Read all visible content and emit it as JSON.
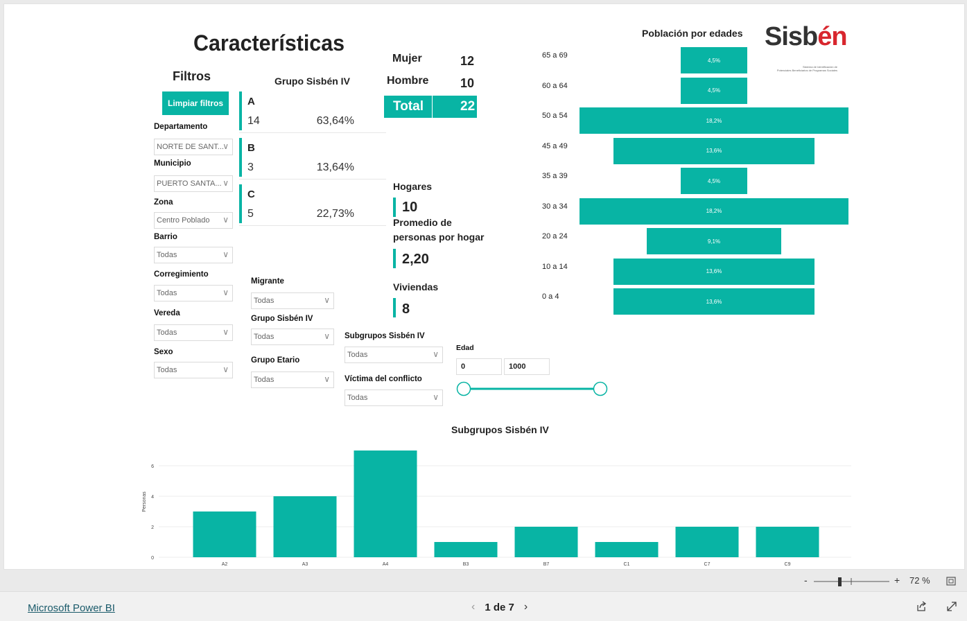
{
  "report": {
    "title": "Características",
    "filters_title": "Filtros",
    "clear_button": "Limpiar filtros",
    "filters": [
      {
        "label": "Departamento",
        "value": "NORTE DE SANT..."
      },
      {
        "label": "Municipio",
        "value": "PUERTO SANTA..."
      },
      {
        "label": "Zona",
        "value": "Centro Poblado"
      },
      {
        "label": "Barrio",
        "value": "Todas"
      },
      {
        "label": "Corregimiento",
        "value": "Todas"
      },
      {
        "label": "Vereda",
        "value": "Todas"
      },
      {
        "label": "Sexo",
        "value": "Todas"
      }
    ],
    "mid_filters": [
      {
        "label": "Migrante",
        "value": "Todas"
      },
      {
        "label": "Grupo Sisbén IV",
        "value": "Todas"
      },
      {
        "label": "Grupo Etario",
        "value": "Todas"
      }
    ],
    "right_filters": [
      {
        "label": "Subgrupos Sisbén IV",
        "value": "Todas"
      },
      {
        "label": "Víctima del conflicto",
        "value": "Todas"
      }
    ],
    "edad": {
      "label": "Edad",
      "min": "0",
      "max": "1000"
    },
    "grupo": {
      "title": "Grupo Sisbén IV",
      "cards": [
        {
          "letter": "A",
          "count": "14",
          "pct": "63,64%"
        },
        {
          "letter": "B",
          "count": "3",
          "pct": "13,64%"
        },
        {
          "letter": "C",
          "count": "5",
          "pct": "22,73%"
        }
      ]
    },
    "sexo": {
      "mujer_label": "Mujer",
      "mujer_value": "12",
      "hombre_label": "Hombre",
      "hombre_value": "10",
      "total_label": "Total",
      "total_value": "22"
    },
    "hogares": {
      "label": "Hogares",
      "value": "10"
    },
    "promedio": {
      "label_1": "Promedio de",
      "label_2": "personas por hogar",
      "value": "2,20"
    },
    "viviendas": {
      "label": "Viviendas",
      "value": "8"
    },
    "logo": {
      "text_1": "Sisb",
      "text_2": "én",
      "tagline_1": "Sistema de Identificación de",
      "tagline_2": "Potenciales Beneficiarios de Programas Sociales"
    },
    "accent": "#08b4a4"
  },
  "chart_data": [
    {
      "type": "bar",
      "orientation": "horizontal-centered",
      "title": "Población por edades",
      "categories": [
        "65 a 69",
        "60 a 64",
        "50 a 54",
        "45 a 49",
        "35 a 39",
        "30 a 34",
        "20 a 24",
        "10 a 14",
        "0 a 4"
      ],
      "values": [
        4.5,
        4.5,
        18.2,
        13.6,
        4.5,
        18.2,
        9.1,
        13.6,
        13.6
      ],
      "labels": [
        "4,5%",
        "4,5%",
        "18,2%",
        "13,6%",
        "4,5%",
        "18,2%",
        "9,1%",
        "13,6%",
        "13,6%"
      ]
    },
    {
      "type": "bar",
      "title": "Subgrupos Sisbén IV",
      "categories": [
        "A2",
        "A3",
        "A4",
        "B3",
        "B7",
        "C1",
        "C7",
        "C9"
      ],
      "values": [
        3,
        4,
        7,
        1,
        2,
        1,
        2,
        2
      ],
      "ylabel": "Personas",
      "yticks": [
        "0",
        "2",
        "4",
        "6"
      ],
      "ylim": [
        0,
        7
      ],
      "grid": true
    }
  ],
  "toolbar": {
    "zoom_minus": "-",
    "zoom_plus": "+",
    "zoom_level": "72 %"
  },
  "footer": {
    "brand": "Microsoft Power BI",
    "page_indicator": "1 de 7"
  }
}
